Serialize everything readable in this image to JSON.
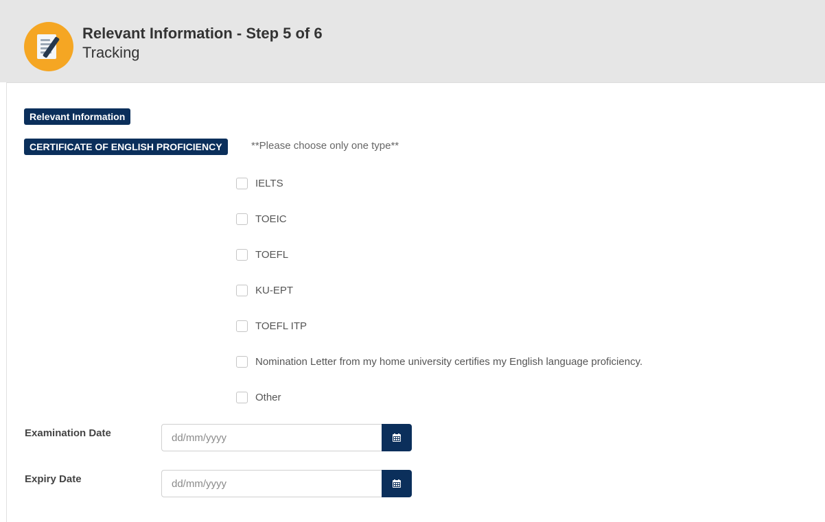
{
  "header": {
    "title": "Relevant Information - Step 5 of 6",
    "subtitle": "Tracking",
    "icon": "document-edit-icon",
    "icon_color": "#f5a623"
  },
  "section": {
    "badge": "Relevant Information",
    "certificate_badge": "CERTIFICATE OF ENGLISH PROFICIENCY",
    "note": "**Please choose only one type**"
  },
  "options": [
    {
      "label": "IELTS",
      "checked": false
    },
    {
      "label": "TOEIC",
      "checked": false
    },
    {
      "label": "TOEFL",
      "checked": false
    },
    {
      "label": "KU-EPT",
      "checked": false
    },
    {
      "label": "TOEFL ITP",
      "checked": false
    },
    {
      "label": "Nomination Letter from my home university certifies my English language proficiency.",
      "checked": false
    },
    {
      "label": "Other",
      "checked": false
    }
  ],
  "fields": {
    "exam_date": {
      "label": "Examination Date",
      "placeholder": "dd/mm/yyyy",
      "value": ""
    },
    "expiry_date": {
      "label": "Expiry Date",
      "placeholder": "dd/mm/yyyy",
      "value": ""
    }
  },
  "colors": {
    "primary": "#0b2f5b",
    "header_bg": "#e6e6e6"
  }
}
